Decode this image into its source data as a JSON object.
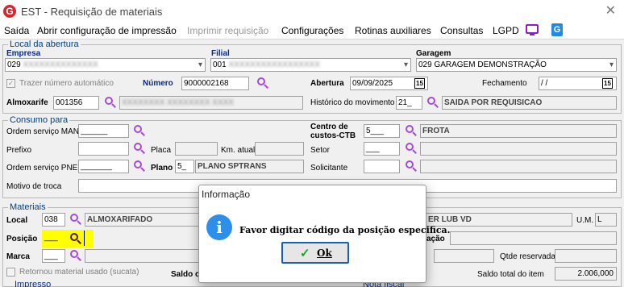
{
  "window": {
    "title": "EST - Requisição de materiais",
    "close_glyph": "✕"
  },
  "menu": {
    "items": [
      "Saída",
      "Abrir configuração de impressão",
      "Imprimir requisição",
      "Configurações",
      "Rotinas auxiliares",
      "Consultas",
      "LGPD"
    ],
    "disabled": [
      "Imprimir requisição"
    ],
    "icons": [
      "screen-icon",
      "document-icon"
    ]
  },
  "local_abertura": {
    "title": "Local da abertura",
    "empresa_label": "Empresa",
    "empresa_code": "029",
    "filial_label": "Filial",
    "filial_code": "001",
    "garagem_label": "Garagem",
    "garagem_value": "029 GARAGEM DEMONSTRAÇÃO",
    "trazer_numero_label": "Trazer número automático",
    "trazer_numero_checked": true,
    "numero_label": "Número",
    "numero_value": "9000002168",
    "abertura_label": "Abertura",
    "abertura_value": "09/09/2025",
    "abertura_cal": "15",
    "fechamento_label": "Fechamento",
    "fechamento_value": "/ /",
    "fechamento_cal": "15",
    "almoxarife_label": "Almoxarife",
    "almoxarife_code": "001356",
    "historico_label": "Histórico do movimento",
    "historico_code": "21_",
    "historico_desc": "SAIDA POR REQUISICAO"
  },
  "consumo": {
    "title": "Consumo para",
    "os_man_label": "Ordem serviço MAN",
    "os_man_value": "______",
    "prefixo_label": "Prefixo",
    "placa_label": "Placa",
    "km_label": "Km. atual",
    "os_pne_label": "Ordem serviço PNE",
    "os_pne_value": "_______",
    "plano_label": "Plano",
    "plano_code": "5_",
    "plano_desc": "PLANO SPTRANS",
    "centro_label_1": "Centro de",
    "centro_label_2": "custos-CTB",
    "centro_code": "5___",
    "centro_desc": "FROTA",
    "setor_label": "Setor",
    "setor_code": "___",
    "solicitante_label": "Solicitante",
    "motivo_label": "Motivo de troca"
  },
  "materiais": {
    "title": "Materiais",
    "local_label": "Local",
    "local_code": "038",
    "local_desc": "ALMOXARIFADO",
    "material_desc_partial": "ER LUB VD",
    "um_label": "U.M.",
    "um_value": "L",
    "posicao_label": "Posição",
    "posicao_value": "___",
    "localizacao_label_partial": "ação",
    "marca_label": "Marca",
    "marca_value": "___",
    "qtde_reservada_label": "Qtde reservada",
    "retornou_label": "Retornou material usado (sucata)",
    "saldo_partial_label": "Saldo c",
    "saldo_total_label": "Saldo total do item",
    "saldo_total_value": "2.006,000"
  },
  "bottom": {
    "impresso_label": "Impresso",
    "nota_fiscal_label": "Nota fiscal"
  },
  "dialog": {
    "title": "Informação",
    "message": "Favor digitar código da posição especifica.",
    "info_glyph": "i",
    "ok_check": "✓",
    "ok_label": "Ok"
  }
}
